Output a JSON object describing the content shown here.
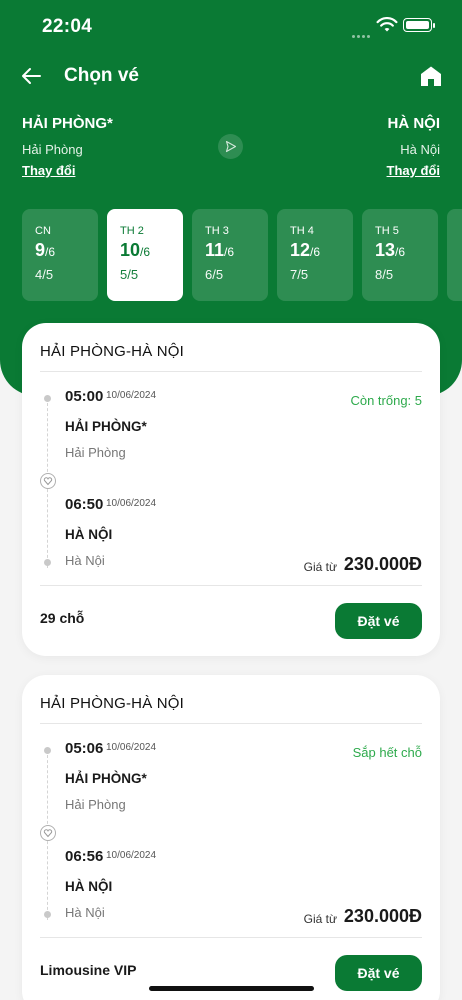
{
  "status_bar": {
    "time": "22:04"
  },
  "header": {
    "title": "Chọn vé",
    "back_icon": "arrow-left-icon",
    "home_icon": "home-icon"
  },
  "route": {
    "from": {
      "code": "HẢI PHÒNG*",
      "name": "Hải Phòng",
      "change_label": "Thay đổi"
    },
    "to": {
      "code": "HÀ NỘI",
      "name": "Hà Nội",
      "change_label": "Thay đổi"
    },
    "swap_icon": "send-icon"
  },
  "days": [
    {
      "weekday": "CN",
      "day": "9",
      "month": "/6",
      "lunar": "4/5",
      "active": false
    },
    {
      "weekday": "TH 2",
      "day": "10",
      "month": "/6",
      "lunar": "5/5",
      "active": true
    },
    {
      "weekday": "TH 3",
      "day": "11",
      "month": "/6",
      "lunar": "6/5",
      "active": false
    },
    {
      "weekday": "TH 4",
      "day": "12",
      "month": "/6",
      "lunar": "7/5",
      "active": false
    },
    {
      "weekday": "TH 5",
      "day": "13",
      "month": "/6",
      "lunar": "8/5",
      "active": false
    }
  ],
  "trips": [
    {
      "route_title": "HẢI PHÒNG-HÀ NỘI",
      "departure": {
        "time": "05:00",
        "date": "10/06/2024",
        "station": "HẢI PHÒNG*",
        "city": "Hải Phòng"
      },
      "arrival": {
        "time": "06:50",
        "date": "10/06/2024",
        "station": "HÀ NỘI",
        "city": "Hà Nội"
      },
      "status": "Còn trống: 5",
      "price_label": "Giá từ",
      "price": "230.000Đ",
      "footer": "29 chỗ",
      "book_label": "Đặt vé"
    },
    {
      "route_title": "HẢI PHÒNG-HÀ NỘI",
      "departure": {
        "time": "05:06",
        "date": "10/06/2024",
        "station": "HẢI PHÒNG*",
        "city": "Hải Phòng"
      },
      "arrival": {
        "time": "06:56",
        "date": "10/06/2024",
        "station": "HÀ NỘI",
        "city": "Hà Nội"
      },
      "status": "Sắp hết chỗ",
      "price_label": "Giá từ",
      "price": "230.000Đ",
      "footer": "Limousine VIP",
      "book_label": "Đặt vé"
    }
  ],
  "colors": {
    "brand": "#0a7a34",
    "status_green": "#2eaa4c"
  }
}
